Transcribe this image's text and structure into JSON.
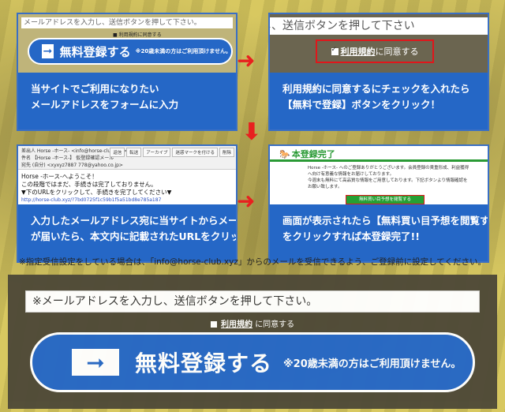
{
  "steps": [
    {
      "shot": {
        "input_text": "メールアドレスを入力し、送信ボタンを押して下さい。",
        "agree_text": "■ 利用規約に同意する",
        "button_label": "無料登録する",
        "button_note": "※20歳未満の方はご利用頂けません。"
      },
      "caption": [
        "当サイトでご利用になりたい",
        "メールアドレスをフォームに入力"
      ]
    },
    {
      "shot": {
        "input_text": "し、送信ボタンを押して下さい",
        "agree_link": "利用規約",
        "agree_rest": "に同意する"
      },
      "caption": [
        "利用規約に同意するにチェックを入れたら",
        "【無料で登録】ボタンをクリック！"
      ]
    },
    {
      "shot": {
        "from": "差出人 Horse -ホース- <info@horse-club.xyz>",
        "subject": "件名 【Horse -ホース-】 仮登録確認メール",
        "to": "宛先 (自分) <xyxyz7887 778@yahoo.co.jp>",
        "tools": [
          "返信",
          "転送",
          "アーカイブ",
          "迷惑マークを付ける",
          "削除"
        ],
        "body": [
          "Horse -ホース-へようこそ！",
          "この段階ではまだ、手続きは完了しておりません。",
          "",
          "▼下のURLをクリックして、手続きを完了してください▼"
        ],
        "url": "http://horse-club.xyz/?7bd0725f1c59b1f5a51bd8e785a187"
      },
      "caption": [
        "入力したメールアドレス宛に当サイトからメール",
        "が届いたら、本文内に記載されたURLをクリック!!"
      ]
    },
    {
      "shot": {
        "title": "本登録完了",
        "text": [
          "Horse -ホース- へのご登録ありがとうございます。会員登録の貴重形成、利益獲得",
          "へ向け有意義な情報をお届けしております。",
          "今週末も無料にて高品質な情報をご用意しております。下記ボタンより情報確認を",
          "お願い致します。"
        ],
        "button_label": "無料買い目予想を閲覧する"
      },
      "caption": [
        "画面が表示されたら【無料買い目予想を閲覧する】",
        "をクリックすれば本登録完了!!"
      ]
    }
  ],
  "notice": "※指定受信設定をしている場合は、「info@horse-club.xyz」からのメールを受信できるよう、ご登録前に設定してください。",
  "form": {
    "email_placeholder": "※メールアドレスを入力し、送信ボタンを押して下さい。",
    "agree_link": "利用規約",
    "agree_rest": "に同意する",
    "submit_label": "無料登録する",
    "submit_note": "※20歳未満の方はご利用頂けません。"
  },
  "colors": {
    "brand_blue": "#2567c6",
    "arrow_red": "#e8201f",
    "success_green": "#2a9a35"
  },
  "icons": {
    "arrow_in_button": "right-arrow-icon",
    "step_arrows": "red-arrow-icon",
    "horse_logo": "horse-icon"
  }
}
